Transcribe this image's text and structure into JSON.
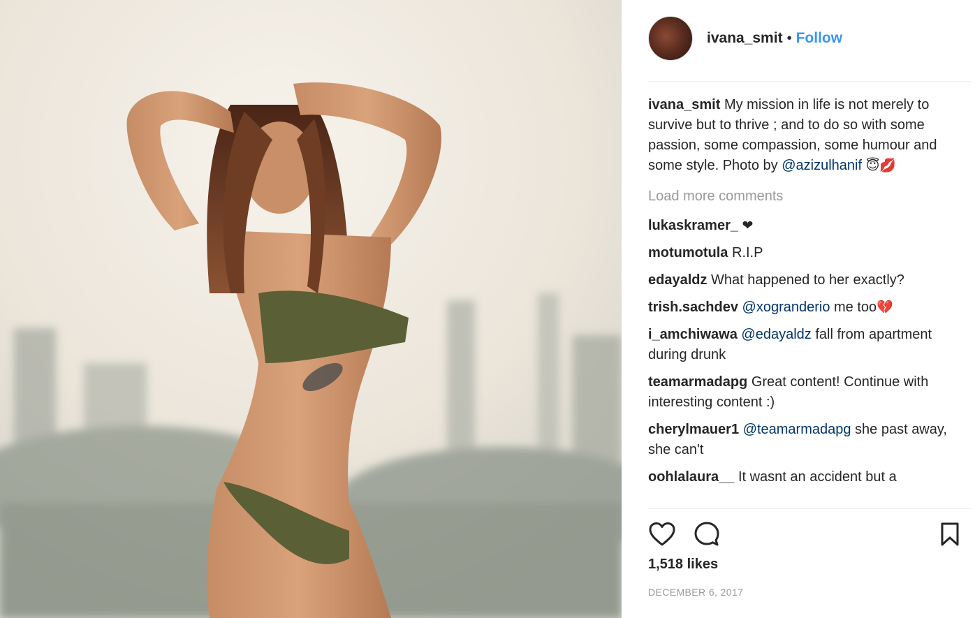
{
  "photo": {
    "alt": ""
  },
  "header": {
    "username": "ivana_smit",
    "separator": "•",
    "follow_label": "Follow",
    "accent_color": "#3897f0"
  },
  "caption": {
    "username": "ivana_smit",
    "text": " My mission in life is not merely to survive but to thrive ; and to do so with some passion, some compassion, some humour and some style. Photo by ",
    "mention": "@azizulhanif",
    "emoji": "😇💋"
  },
  "load_more_label": "Load more comments",
  "comments": [
    {
      "username": "lukaskramer_",
      "pre": " ",
      "mention": "",
      "post": "",
      "emoji": "❤"
    },
    {
      "username": "motumotula",
      "pre": " R.I.P",
      "mention": "",
      "post": "",
      "emoji": ""
    },
    {
      "username": "edayaldz",
      "pre": " What happened to her exactly?",
      "mention": "",
      "post": "",
      "emoji": ""
    },
    {
      "username": "trish.sachdev",
      "pre": " ",
      "mention": "@xogranderio",
      "post": " me too",
      "emoji": "💔"
    },
    {
      "username": "i_amchiwawa",
      "pre": " ",
      "mention": "@edayaldz",
      "post": " fall from apartment during drunk",
      "emoji": ""
    },
    {
      "username": "teamarmadapg",
      "pre": " Great content! Continue with interesting content :)",
      "mention": "",
      "post": "",
      "emoji": ""
    },
    {
      "username": "cherylmauer1",
      "pre": " ",
      "mention": "@teamarmadapg",
      "post": " she past away, she can't",
      "emoji": ""
    },
    {
      "username": "oohlalaura__",
      "pre": " It wasnt an accident but a",
      "mention": "",
      "post": "",
      "emoji": ""
    }
  ],
  "actions": {
    "like_icon": "heart-icon",
    "comment_icon": "comment-bubble-icon",
    "save_icon": "bookmark-icon"
  },
  "likes": "1,518 likes",
  "date": "DECEMBER 6, 2017",
  "colors": {
    "mention": "#003569",
    "muted": "#999999",
    "text": "#262626"
  }
}
